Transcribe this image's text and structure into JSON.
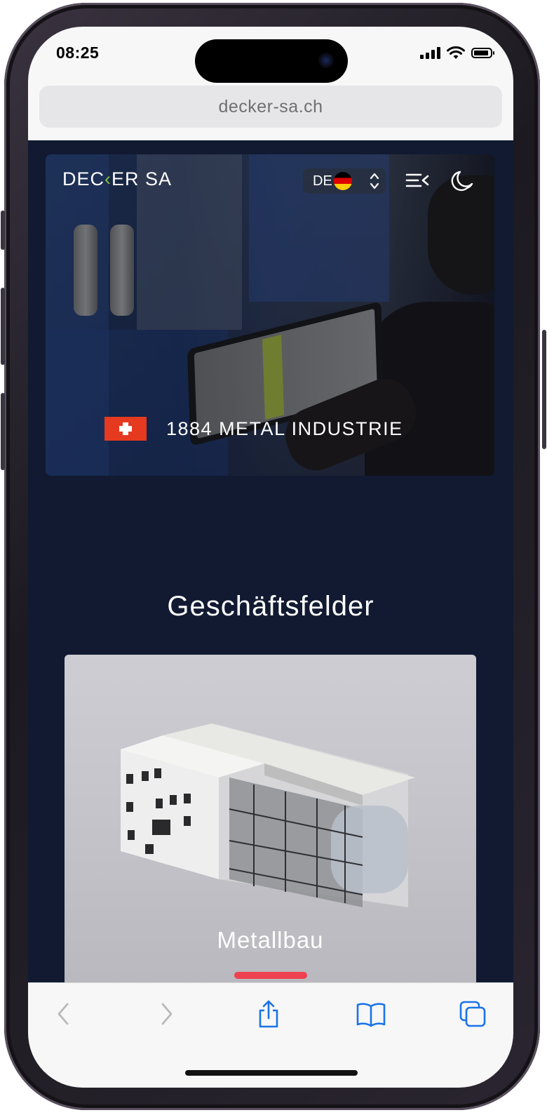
{
  "status": {
    "time": "08:25"
  },
  "browser": {
    "url": "decker-sa.ch"
  },
  "site": {
    "logo_text_1": "DEC",
    "logo_text_2": "ER SA",
    "language": "DE",
    "tagline": "1884 METAL INDUSTRIE"
  },
  "section": {
    "title": "Geschäftsfelder",
    "card_label": "Metallbau"
  },
  "colors": {
    "page_bg": "#111a31",
    "accent_red": "#ef4150",
    "swiss_red": "#e53a1f",
    "logo_green": "#7fc63f",
    "safari_blue": "#1a73e8"
  },
  "icons": {
    "menu": "menu-collapse-icon",
    "theme": "moon-icon",
    "back": "chevron-left-icon",
    "forward": "chevron-right-icon",
    "share": "share-icon",
    "bookmarks": "book-icon",
    "tabs": "tabs-icon"
  }
}
